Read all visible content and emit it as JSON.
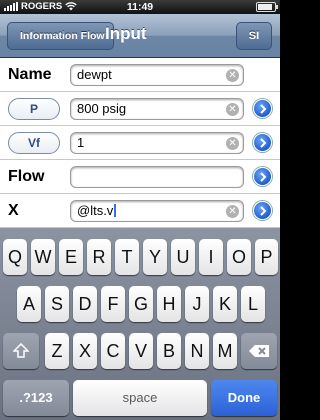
{
  "status_bar": {
    "carrier": "ROGERS",
    "time": "11:49"
  },
  "nav": {
    "back_label": "Information Flow",
    "title": "Input",
    "right_button": "SI"
  },
  "form": {
    "name": {
      "label": "Name",
      "value": "dewpt"
    },
    "p": {
      "label": "P",
      "value": "800 psig"
    },
    "vf": {
      "label": "Vf",
      "value": "1"
    },
    "flow": {
      "label": "Flow",
      "value": ""
    },
    "x": {
      "label": "X",
      "value": "@lts.v"
    }
  },
  "keyboard": {
    "row1": [
      "Q",
      "W",
      "E",
      "R",
      "T",
      "Y",
      "U",
      "I",
      "O",
      "P"
    ],
    "row2": [
      "A",
      "S",
      "D",
      "F",
      "G",
      "H",
      "J",
      "K",
      "L"
    ],
    "row3": [
      "Z",
      "X",
      "C",
      "V",
      "B",
      "N",
      "M"
    ],
    "numbers_key": ".?123",
    "space_key": "space",
    "done_key": "Done"
  },
  "colors": {
    "accent": "#2a62d7",
    "nav_bar": "#6d86a6"
  }
}
